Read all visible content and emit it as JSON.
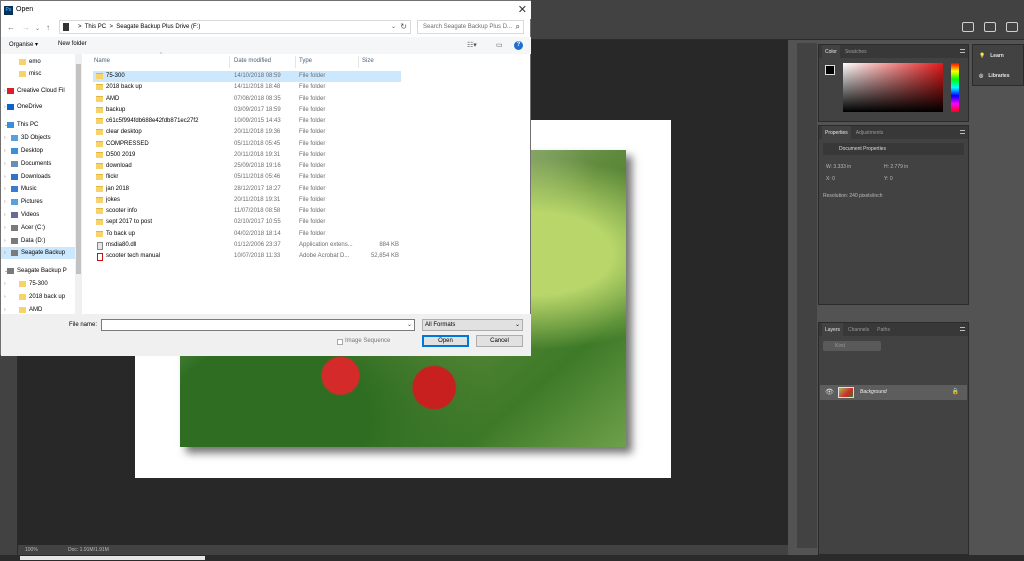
{
  "dialog": {
    "title": "Open",
    "app_badge": "Ps",
    "address": {
      "crumbs": [
        "This PC",
        "Seagate Backup Plus Drive (F:)"
      ],
      "separator": ">"
    },
    "search_placeholder": "Search Seagate Backup Plus D...",
    "toolbar": {
      "organise": "Organise ▾",
      "new_folder": "New folder"
    },
    "nav": [
      {
        "label": "emo",
        "icon": "folder-icon"
      },
      {
        "label": "misc",
        "icon": "folder-icon"
      },
      {
        "label": "Creative Cloud Fil",
        "icon": "creative-cloud-icon"
      },
      {
        "label": "OneDrive",
        "icon": "onedrive-icon"
      },
      {
        "label": "This PC",
        "icon": "pc-icon"
      },
      {
        "label": "3D Objects",
        "icon": "3d-objects-icon"
      },
      {
        "label": "Desktop",
        "icon": "desktop-icon"
      },
      {
        "label": "Documents",
        "icon": "documents-icon"
      },
      {
        "label": "Downloads",
        "icon": "downloads-icon"
      },
      {
        "label": "Music",
        "icon": "music-icon"
      },
      {
        "label": "Pictures",
        "icon": "pictures-icon"
      },
      {
        "label": "Videos",
        "icon": "videos-icon"
      },
      {
        "label": "Acer (C:)",
        "icon": "drive-icon"
      },
      {
        "label": "Data (D:)",
        "icon": "drive-icon"
      },
      {
        "label": "Seagate Backup",
        "icon": "drive-icon"
      },
      {
        "label": "Seagate Backup P",
        "icon": "drive-icon"
      },
      {
        "label": "75-300",
        "icon": "folder-icon"
      },
      {
        "label": "2018 back up",
        "icon": "folder-icon"
      },
      {
        "label": "AMD",
        "icon": "folder-icon"
      }
    ],
    "columns": {
      "name": "Name",
      "date": "Date modified",
      "type": "Type",
      "size": "Size"
    },
    "files": [
      {
        "name": "75-300",
        "date": "14/10/2018 08:59",
        "type": "File folder",
        "size": ""
      },
      {
        "name": "2018 back up",
        "date": "14/11/2018 18:48",
        "type": "File folder",
        "size": ""
      },
      {
        "name": "AMD",
        "date": "07/08/2018 08:35",
        "type": "File folder",
        "size": ""
      },
      {
        "name": "backup",
        "date": "03/09/2017 18:59",
        "type": "File folder",
        "size": ""
      },
      {
        "name": "c61c5f994fdb688e42fdb871ec27f2",
        "date": "10/09/2015 14:43",
        "type": "File folder",
        "size": ""
      },
      {
        "name": "clear desktop",
        "date": "20/11/2018 19:36",
        "type": "File folder",
        "size": ""
      },
      {
        "name": "COMPRESSED",
        "date": "05/11/2018 05:45",
        "type": "File folder",
        "size": ""
      },
      {
        "name": "D500 2019",
        "date": "20/11/2018 19:31",
        "type": "File folder",
        "size": ""
      },
      {
        "name": "download",
        "date": "25/09/2018 19:16",
        "type": "File folder",
        "size": ""
      },
      {
        "name": "flickr",
        "date": "05/11/2018 05:46",
        "type": "File folder",
        "size": ""
      },
      {
        "name": "jan 2018",
        "date": "28/12/2017 18:27",
        "type": "File folder",
        "size": ""
      },
      {
        "name": "jokes",
        "date": "20/11/2018 19:31",
        "type": "File folder",
        "size": ""
      },
      {
        "name": "scooter info",
        "date": "11/07/2018 08:58",
        "type": "File folder",
        "size": ""
      },
      {
        "name": "sept 2017 to post",
        "date": "02/10/2017 10:55",
        "type": "File folder",
        "size": ""
      },
      {
        "name": "To back up",
        "date": "04/02/2018 18:14",
        "type": "File folder",
        "size": ""
      },
      {
        "name": "msdia80.dll",
        "date": "01/12/2006 23:37",
        "type": "Application extens...",
        "size": "884 KB"
      },
      {
        "name": "scooter tech manual",
        "date": "10/07/2018 11:33",
        "type": "Adobe Acrobat D...",
        "size": "52,854 KB"
      }
    ],
    "file_name_label": "File name:",
    "file_name_value": "",
    "format": "All Formats",
    "image_sequence": "Image Sequence",
    "open_btn": "Open",
    "cancel_btn": "Cancel"
  },
  "photoshop": {
    "zoom": "100%",
    "doc_info": "Doc: 1.91M/1.91M",
    "color_tabs": [
      "Color",
      "Swatches"
    ],
    "props_tabs": [
      "Properties",
      "Adjustments"
    ],
    "props_title": "Document Properties",
    "props": {
      "w": "W: 3.333 in",
      "h": "H: 2.779 in",
      "x": "X: 0",
      "y": "Y: 0",
      "res": "Resolution: 240 pixels/inch"
    },
    "layers_tabs": [
      "Layers",
      "Channels",
      "Paths"
    ],
    "layers_search": "Kind",
    "layer_name": "Background",
    "learn": "Learn",
    "libraries": "Libraries"
  }
}
